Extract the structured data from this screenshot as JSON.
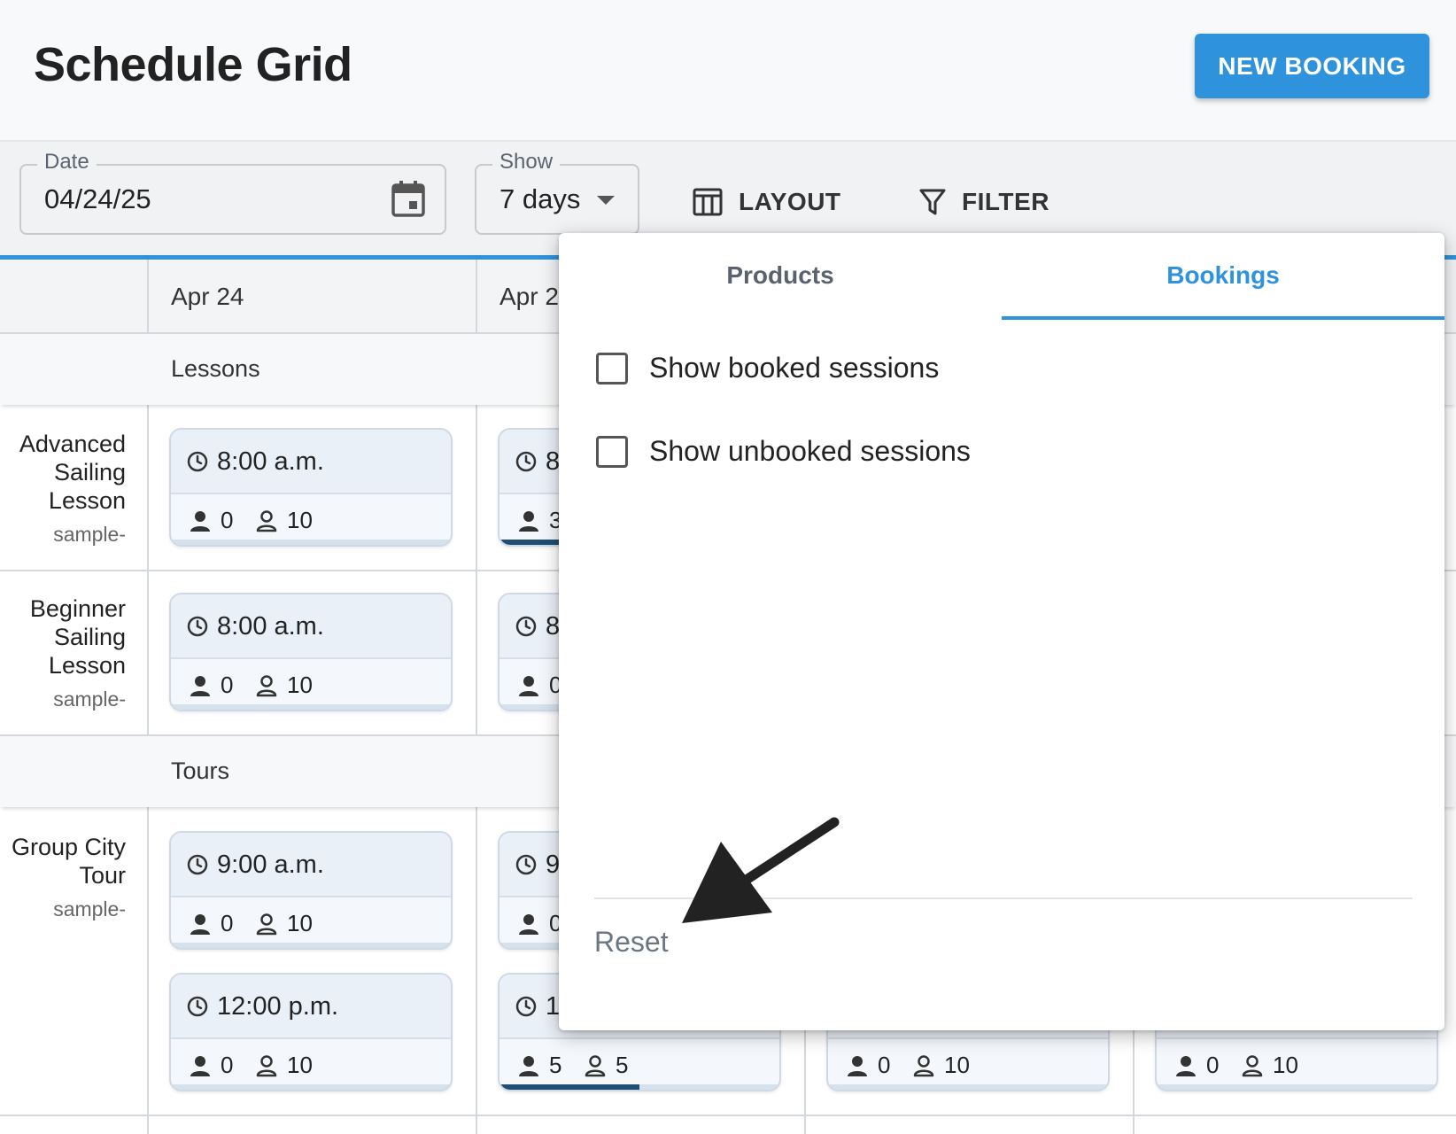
{
  "header": {
    "title": "Schedule Grid",
    "new_booking_label": "NEW BOOKING"
  },
  "toolbar": {
    "date_label": "Date",
    "date_value": "04/24/25",
    "show_label": "Show",
    "show_value": "7 days",
    "layout_label": "LAYOUT",
    "filter_label": "FILTER"
  },
  "grid": {
    "dates": [
      "Apr 24",
      "Apr 2"
    ],
    "categories": [
      "Lessons",
      "Tours"
    ],
    "products": [
      {
        "name": "Advanced Sailing Lesson",
        "sub": "sample-"
      },
      {
        "name": "Beginner Sailing Lesson",
        "sub": "sample-"
      },
      {
        "name": "Group City Tour",
        "sub": "sample-"
      }
    ],
    "cards": [
      {
        "time": "8:00 a.m.",
        "booked": "0",
        "capacity": "10",
        "fill": 0
      },
      {
        "time": "8",
        "booked": "3",
        "capacity": "",
        "fill": 0.3
      },
      {
        "time": "8:00 a.m.",
        "booked": "0",
        "capacity": "10",
        "fill": 0
      },
      {
        "time": "8",
        "booked": "0",
        "capacity": "",
        "fill": 0
      },
      {
        "time": "9:00 a.m.",
        "booked": "0",
        "capacity": "10",
        "fill": 0
      },
      {
        "time": "9",
        "booked": "0",
        "capacity": "",
        "fill": 0
      },
      {
        "time": "12:00 p.m.",
        "booked": "0",
        "capacity": "10",
        "fill": 0
      },
      {
        "time": "1",
        "booked": "5",
        "capacity": "5",
        "fill": 0.5
      },
      {
        "time": "",
        "booked": "0",
        "capacity": "10",
        "fill": 0
      },
      {
        "time": "",
        "booked": "0",
        "capacity": "10",
        "fill": 0
      }
    ]
  },
  "filter_popover": {
    "tabs": [
      "Products",
      "Bookings"
    ],
    "active_tab": "Bookings",
    "options": [
      {
        "label": "Show booked sessions",
        "checked": false
      },
      {
        "label": "Show unbooked sessions",
        "checked": false
      }
    ],
    "reset_label": "Reset"
  },
  "colors": {
    "accent": "#2e92dc",
    "progress_fill": "#1f4d74"
  }
}
